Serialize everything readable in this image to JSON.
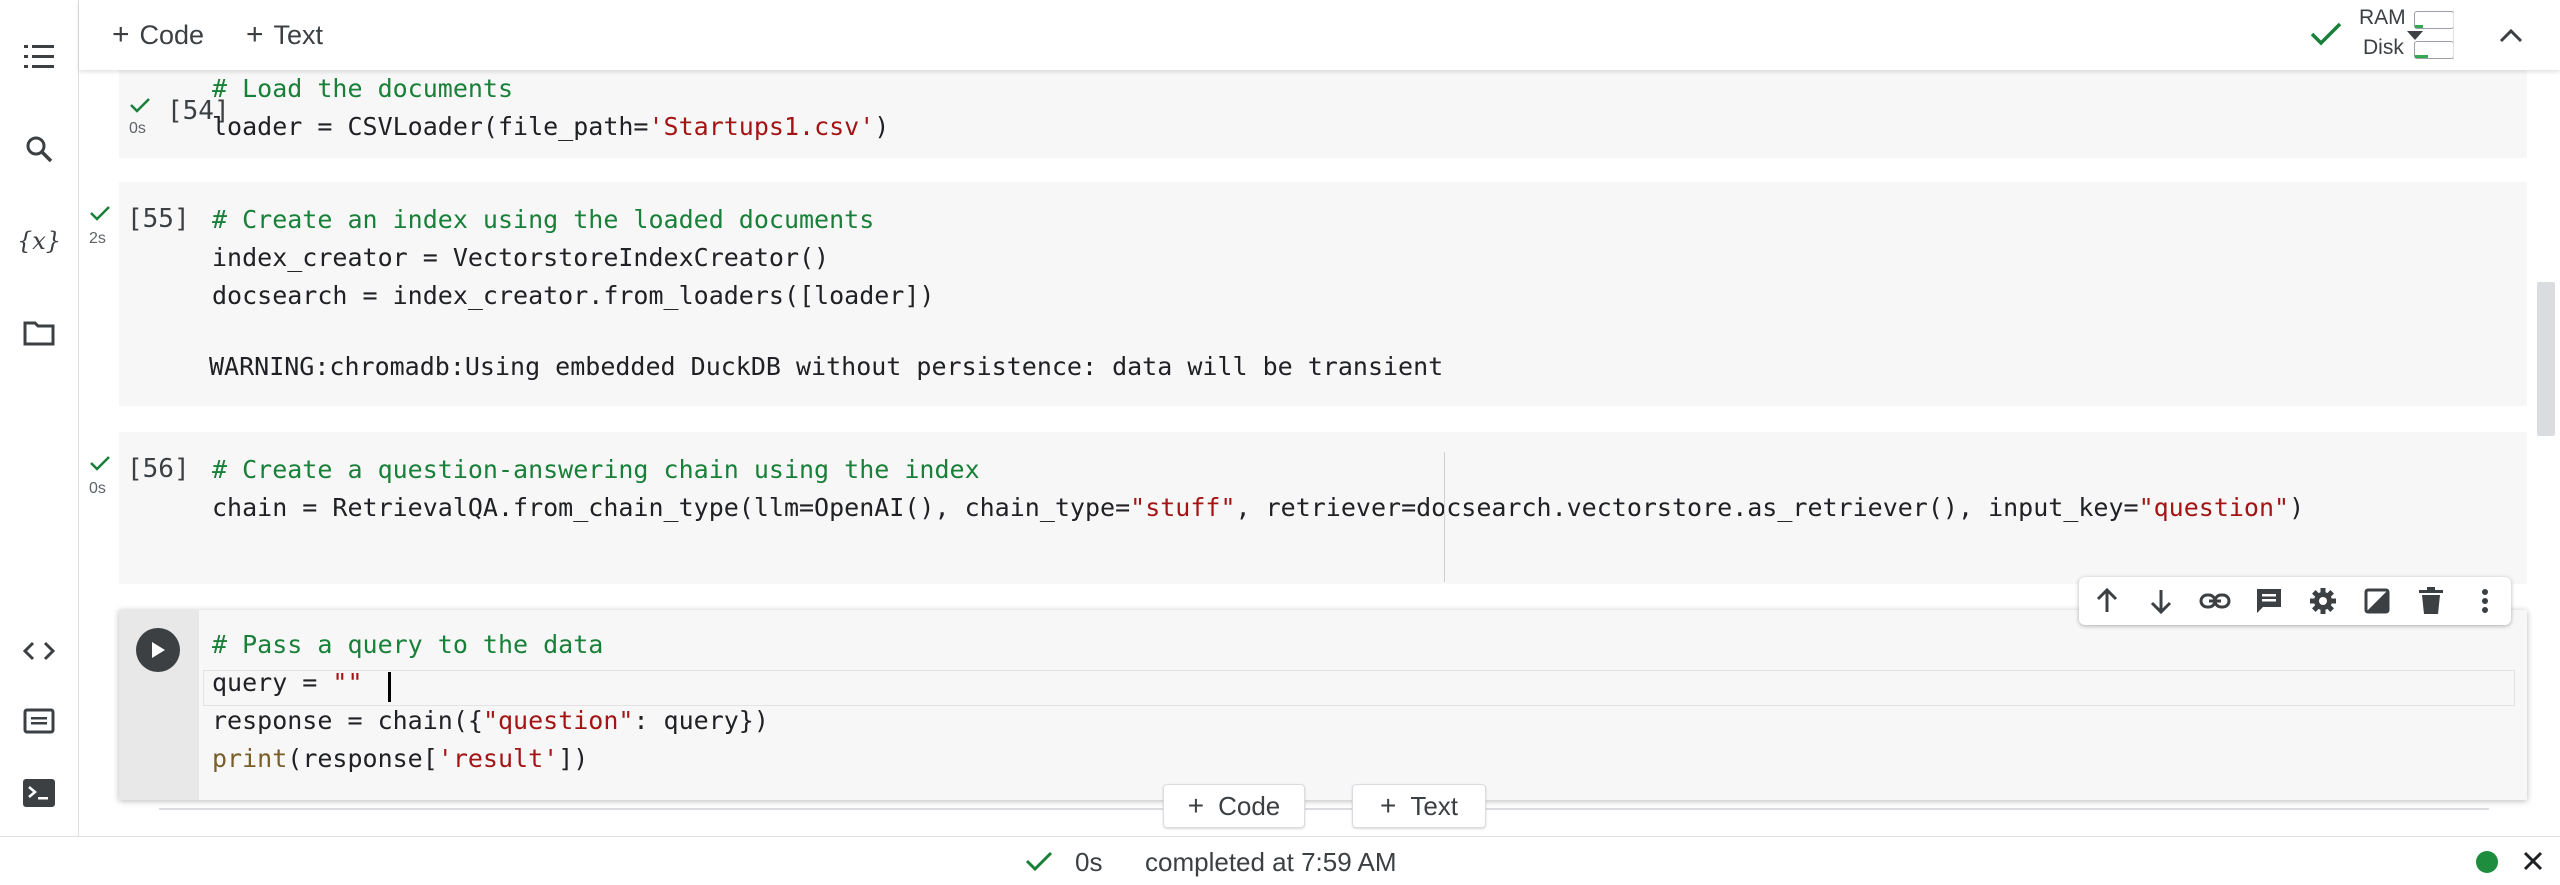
{
  "toolbar": {
    "add_code_label": "Code",
    "add_text_label": "Text",
    "ram_label": "RAM",
    "disk_label": "Disk"
  },
  "cells": [
    {
      "exec_count": "[54]",
      "duration": "0s",
      "lines": [
        {
          "comment": "# Load the documents"
        },
        {
          "pre": "loader = CSVLoader(file_path=",
          "str": "'Startups1.csv'",
          "post": ")"
        }
      ]
    },
    {
      "exec_count": "[55]",
      "duration": "2s",
      "lines": [
        {
          "comment": "# Create an index using the loaded documents"
        },
        {
          "pre": "index_creator = VectorstoreIndexCreator()"
        },
        {
          "pre": "docsearch = index_creator.from_loaders([loader])"
        }
      ],
      "output": "WARNING:chromadb:Using embedded DuckDB without persistence: data will be transient"
    },
    {
      "exec_count": "[56]",
      "duration": "0s",
      "lines": [
        {
          "comment": "# Create a question-answering chain using the index"
        },
        {
          "pre": "chain = RetrievalQA.from_chain_type(llm=OpenAI(), chain_type=",
          "str": "\"stuff\"",
          "mid": ", retriever=docsearch.vectorstore.as_retriever(), input_key=",
          "str2": "\"question\"",
          "post": ")"
        }
      ]
    }
  ],
  "active_cell": {
    "comment": "# Pass a query to the data",
    "query_pre": "query = ",
    "query_str": "\"\"",
    "resp_pre": "response = chain({",
    "resp_str": "\"question\"",
    "resp_post": ": query})",
    "print_fn": "print",
    "print_pre": "(response[",
    "print_str": "'result'",
    "print_post": "])"
  },
  "add_buttons": {
    "code_label": "Code",
    "text_label": "Text"
  },
  "status": {
    "duration": "0s",
    "message": "completed at 7:59 AM"
  },
  "colors": {
    "comment": "#188038",
    "string": "#a31515",
    "check": "#188038",
    "status_ok": "#1e8e3e"
  }
}
